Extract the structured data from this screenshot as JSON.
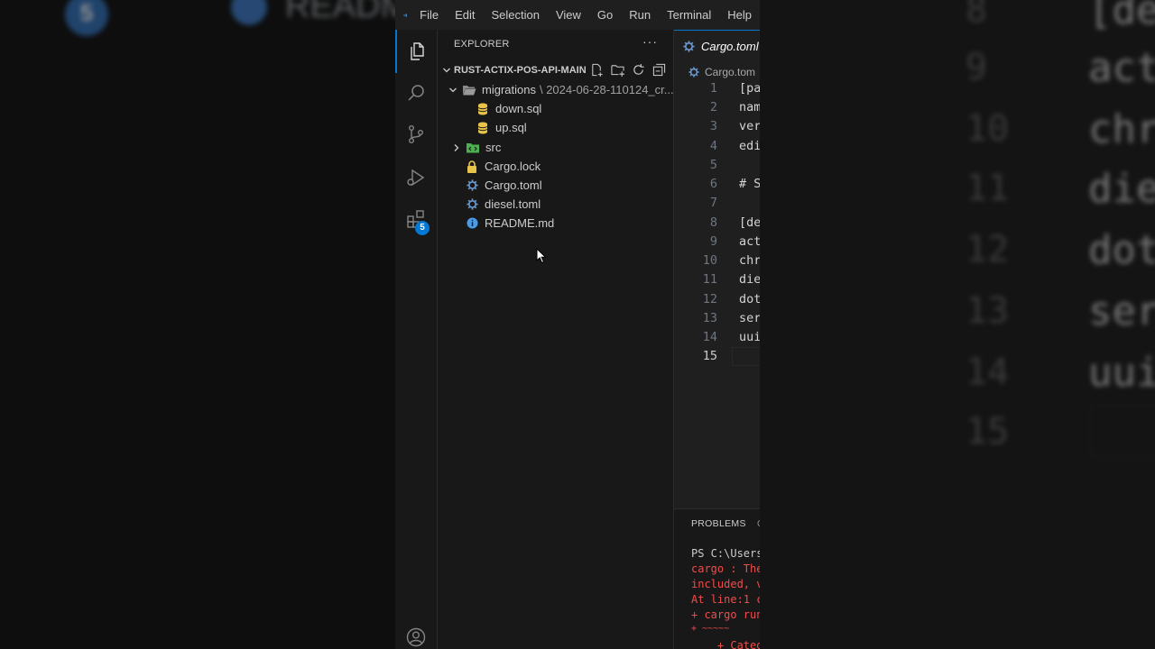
{
  "menu": [
    "File",
    "Edit",
    "Selection",
    "View",
    "Go",
    "Run",
    "Terminal",
    "Help"
  ],
  "activity_bar": {
    "extensions_badge": "5"
  },
  "explorer": {
    "header": "EXPLORER",
    "more": "···",
    "section_title": "RUST-ACTIX-POS-API-MAIN",
    "tree": [
      {
        "label": "migrations",
        "sub": "\\ 2024-06-28-110124_cr..."
      },
      {
        "label": "down.sql"
      },
      {
        "label": "up.sql"
      },
      {
        "label": "src"
      },
      {
        "label": "Cargo.lock"
      },
      {
        "label": "Cargo.toml"
      },
      {
        "label": "diesel.toml"
      },
      {
        "label": "README.md"
      }
    ]
  },
  "editor": {
    "tab": "Cargo.toml",
    "breadcrumb": "Cargo.tom",
    "lines": [
      {
        "n": "1",
        "text": "[pa"
      },
      {
        "n": "2",
        "text": "nam"
      },
      {
        "n": "3",
        "text": "ver"
      },
      {
        "n": "4",
        "text": "edi"
      },
      {
        "n": "5",
        "text": ""
      },
      {
        "n": "6",
        "text": "# S"
      },
      {
        "n": "7",
        "text": ""
      },
      {
        "n": "8",
        "text": "[de"
      },
      {
        "n": "9",
        "text": "act"
      },
      {
        "n": "10",
        "text": "chr"
      },
      {
        "n": "11",
        "text": "die"
      },
      {
        "n": "12",
        "text": "dot"
      },
      {
        "n": "13",
        "text": "ser"
      },
      {
        "n": "14",
        "text": "uui"
      },
      {
        "n": "15",
        "text": ""
      }
    ]
  },
  "panel": {
    "tab": "PROBLEMS",
    "tab2": "O",
    "terminal": [
      {
        "text": "PS C:\\Users",
        "color": "#cccccc"
      },
      {
        "text": "cargo : The",
        "color": "#f14c4c"
      },
      {
        "text": "included, v",
        "color": "#f14c4c"
      },
      {
        "text": "At line:1 c",
        "color": "#f14c4c"
      },
      {
        "text": "+ cargo run",
        "color": "#f14c4c"
      },
      {
        "text": "+ ~~~~~",
        "color": "#f14c4c"
      },
      {
        "text": "    + Categ",
        "color": "#f14c4c"
      }
    ]
  },
  "background": {
    "left_badge": "5",
    "left_text": "READM",
    "right_lines": [
      {
        "n": "8",
        "text": "[de"
      },
      {
        "n": "9",
        "text": "act"
      },
      {
        "n": "10",
        "text": "chr"
      },
      {
        "n": "11",
        "text": "die"
      },
      {
        "n": "12",
        "text": "dot"
      },
      {
        "n": "13",
        "text": "ser"
      },
      {
        "n": "14",
        "text": "uui"
      },
      {
        "n": "15",
        "text": ""
      }
    ]
  }
}
